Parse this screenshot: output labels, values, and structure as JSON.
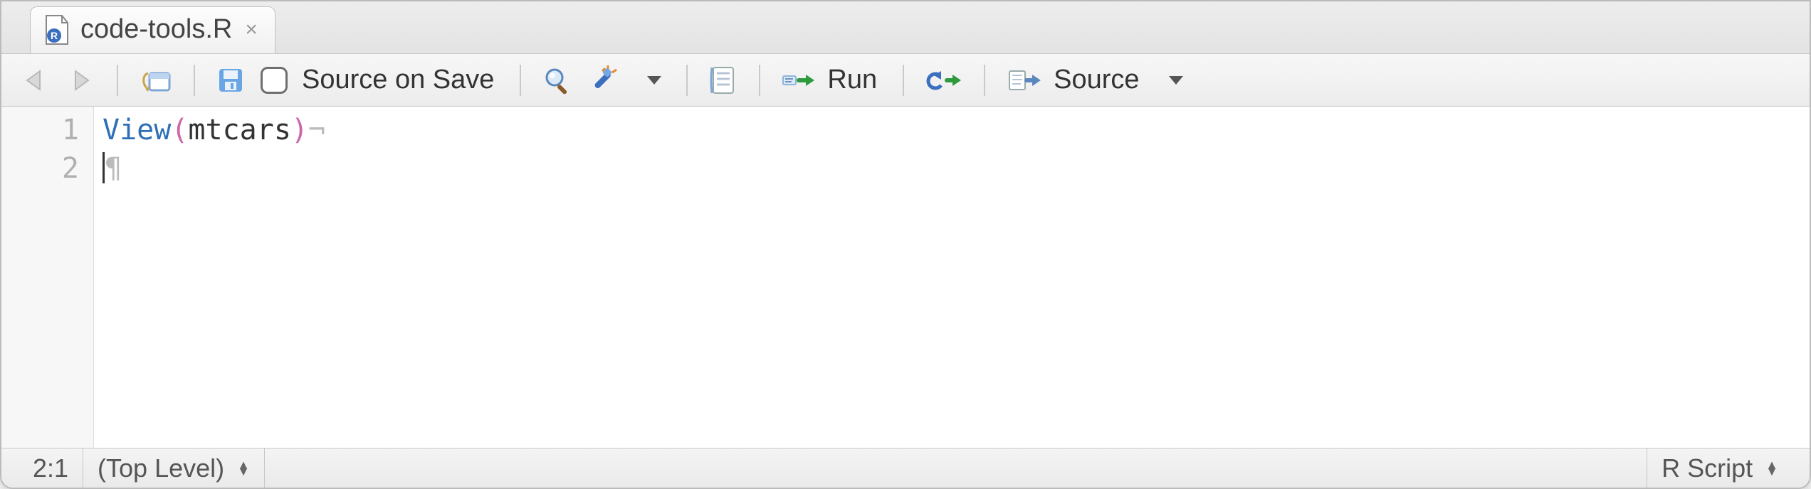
{
  "tab": {
    "filename": "code-tools.R"
  },
  "toolbar": {
    "source_on_save_label": "Source on Save",
    "run_label": "Run",
    "source_label": "Source"
  },
  "editor": {
    "lines": [
      {
        "n": "1",
        "fn": "View",
        "lp": "(",
        "arg": "mtcars",
        "rp": ")",
        "eol": "¬"
      },
      {
        "n": "2",
        "pilcrow": "¶"
      }
    ]
  },
  "status": {
    "cursor": "2:1",
    "scope": "(Top Level)",
    "filetype": "R Script"
  }
}
